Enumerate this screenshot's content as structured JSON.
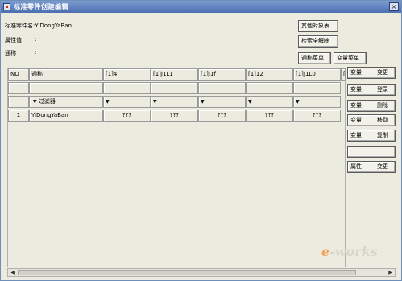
{
  "window": {
    "title": "标准零件创建编辑",
    "close_symbol": "×"
  },
  "info": {
    "part_name_label": "标准零件名:YiDongYaBan",
    "attr_value_label": "属性值",
    "attr_value_sep": ":",
    "common_name_label": "通称",
    "common_name_sep": ":"
  },
  "top_buttons": {
    "other_objects": "其他对象表",
    "remove_all": "检索全解除",
    "common_menu": "通称菜单",
    "variable_menu": "变量菜单"
  },
  "table": {
    "headers": [
      "NO",
      "通称",
      "[1]4",
      "[1]J1L1",
      "[1]J1f",
      "[1]12",
      "[1]J1L0",
      "["
    ],
    "filter_label": "过滤器",
    "filter_arrow": "▼",
    "rows": [
      {
        "no": "1",
        "name": "YiDongYaBan",
        "values": [
          "???",
          "???",
          "???",
          "???",
          "???"
        ]
      }
    ]
  },
  "side_buttons": [
    {
      "left": "变量",
      "right": "变更"
    },
    {
      "left": "变量",
      "right": "登录"
    },
    {
      "left": "变量",
      "right": "删除"
    },
    {
      "left": "变量",
      "right": "移动"
    },
    {
      "left": "变量",
      "right": "复制"
    },
    {
      "left": "",
      "right": ""
    },
    {
      "left": "属性",
      "right": "变更"
    }
  ],
  "scrollbar": {
    "left_arrow": "◀",
    "right_arrow": "▶"
  },
  "watermark": {
    "prefix": "e",
    "text": "-works"
  }
}
